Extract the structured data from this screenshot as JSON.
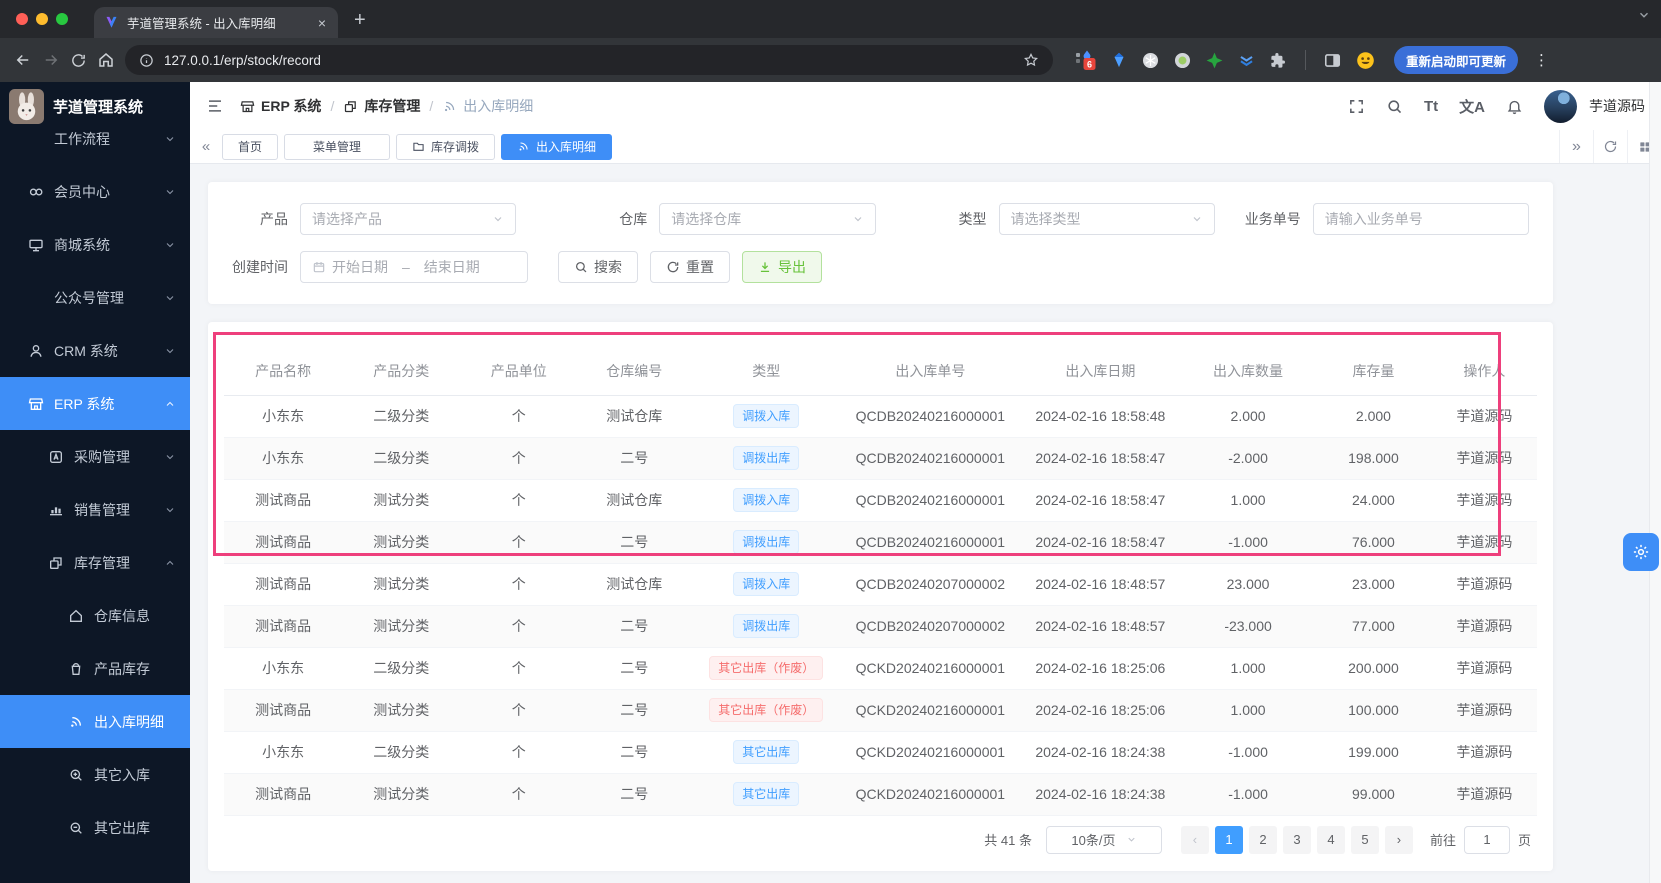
{
  "browser": {
    "tab_title": "芋道管理系统 - 出入库明细",
    "url": "127.0.0.1/erp/stock/record",
    "update_button": "重新启动即可更新",
    "extension_badge": "6"
  },
  "sidebar": {
    "logo_title": "芋道管理系统",
    "items": [
      {
        "label": "工作流程",
        "icon": null,
        "level": 1,
        "chevron": "down",
        "active": false
      },
      {
        "label": "会员中心",
        "icon": "member",
        "level": 1,
        "chevron": "down",
        "active": false
      },
      {
        "label": "商城系统",
        "icon": "mall",
        "level": 1,
        "chevron": "down",
        "active": false
      },
      {
        "label": "公众号管理",
        "icon": null,
        "level": 1,
        "chevron": "down",
        "active": false
      },
      {
        "label": "CRM 系统",
        "icon": "crm",
        "level": 1,
        "chevron": "down",
        "active": false
      },
      {
        "label": "ERP 系统",
        "icon": "erp",
        "level": 1,
        "chevron": "up",
        "active": true
      },
      {
        "label": "采购管理",
        "icon": "purchase",
        "level": 2,
        "chevron": "down",
        "active": false
      },
      {
        "label": "销售管理",
        "icon": "sales",
        "level": 2,
        "chevron": "down",
        "active": false
      },
      {
        "label": "库存管理",
        "icon": "stock",
        "level": 2,
        "chevron": "up",
        "active": false
      },
      {
        "label": "仓库信息",
        "icon": "warehouse",
        "level": 3,
        "chevron": null,
        "active": false
      },
      {
        "label": "产品库存",
        "icon": "product",
        "level": 3,
        "chevron": null,
        "active": false
      },
      {
        "label": "出入库明细",
        "icon": "record",
        "level": 3,
        "chevron": null,
        "active": true
      },
      {
        "label": "其它入库",
        "icon": "zoom-in",
        "level": 3,
        "chevron": null,
        "active": false
      },
      {
        "label": "其它出库",
        "icon": "zoom-out",
        "level": 3,
        "chevron": null,
        "active": false
      }
    ]
  },
  "header": {
    "breadcrumb": [
      {
        "label": "ERP 系统",
        "icon": "erp"
      },
      {
        "label": "库存管理",
        "icon": "stock"
      },
      {
        "label": "出入库明细",
        "icon": "record"
      }
    ],
    "username": "芋道源码"
  },
  "tabsbar": {
    "tabs": [
      {
        "label": "首页",
        "icon": null,
        "active": false,
        "wide": false
      },
      {
        "label": "菜单管理",
        "icon": null,
        "active": false,
        "wide": true
      },
      {
        "label": "库存调拨",
        "icon": "folder",
        "active": false,
        "wide": false
      },
      {
        "label": "出入库明细",
        "icon": "record",
        "active": true,
        "wide": false
      }
    ]
  },
  "filters": {
    "product": {
      "label": "产品",
      "placeholder": "请选择产品"
    },
    "warehouse": {
      "label": "仓库",
      "placeholder": "请选择仓库"
    },
    "type": {
      "label": "类型",
      "placeholder": "请选择类型"
    },
    "biz_no": {
      "label": "业务单号",
      "placeholder": "请输入业务单号"
    },
    "create_time": {
      "label": "创建时间",
      "start_placeholder": "开始日期",
      "separator": "–",
      "end_placeholder": "结束日期"
    },
    "search_button": "搜索",
    "reset_button": "重置",
    "export_button": "导出"
  },
  "table": {
    "columns": [
      "产品名称",
      "产品分类",
      "产品单位",
      "仓库编号",
      "类型",
      "出入库单号",
      "出入库日期",
      "出入库数量",
      "库存量",
      "操作人"
    ],
    "rows": [
      {
        "product": "小东东",
        "category": "二级分类",
        "unit": "个",
        "warehouse": "测试仓库",
        "type": "调拨入库",
        "type_style": "blue",
        "order_no": "QCDB20240216000001",
        "date": "2024-02-16 18:58:48",
        "qty": "2.000",
        "stock": "2.000",
        "operator": "芋道源码"
      },
      {
        "product": "小东东",
        "category": "二级分类",
        "unit": "个",
        "warehouse": "二号",
        "type": "调拨出库",
        "type_style": "blue",
        "order_no": "QCDB20240216000001",
        "date": "2024-02-16 18:58:47",
        "qty": "-2.000",
        "stock": "198.000",
        "operator": "芋道源码"
      },
      {
        "product": "测试商品",
        "category": "测试分类",
        "unit": "个",
        "warehouse": "测试仓库",
        "type": "调拨入库",
        "type_style": "blue",
        "order_no": "QCDB20240216000001",
        "date": "2024-02-16 18:58:47",
        "qty": "1.000",
        "stock": "24.000",
        "operator": "芋道源码"
      },
      {
        "product": "测试商品",
        "category": "测试分类",
        "unit": "个",
        "warehouse": "二号",
        "type": "调拨出库",
        "type_style": "blue",
        "order_no": "QCDB20240216000001",
        "date": "2024-02-16 18:58:47",
        "qty": "-1.000",
        "stock": "76.000",
        "operator": "芋道源码"
      },
      {
        "product": "测试商品",
        "category": "测试分类",
        "unit": "个",
        "warehouse": "测试仓库",
        "type": "调拨入库",
        "type_style": "blue",
        "order_no": "QCDB20240207000002",
        "date": "2024-02-16 18:48:57",
        "qty": "23.000",
        "stock": "23.000",
        "operator": "芋道源码"
      },
      {
        "product": "测试商品",
        "category": "测试分类",
        "unit": "个",
        "warehouse": "二号",
        "type": "调拨出库",
        "type_style": "blue",
        "order_no": "QCDB20240207000002",
        "date": "2024-02-16 18:48:57",
        "qty": "-23.000",
        "stock": "77.000",
        "operator": "芋道源码"
      },
      {
        "product": "小东东",
        "category": "二级分类",
        "unit": "个",
        "warehouse": "二号",
        "type": "其它出库（作废）",
        "type_style": "red",
        "order_no": "QCKD20240216000001",
        "date": "2024-02-16 18:25:06",
        "qty": "1.000",
        "stock": "200.000",
        "operator": "芋道源码"
      },
      {
        "product": "测试商品",
        "category": "测试分类",
        "unit": "个",
        "warehouse": "二号",
        "type": "其它出库（作废）",
        "type_style": "red",
        "order_no": "QCKD20240216000001",
        "date": "2024-02-16 18:25:06",
        "qty": "1.000",
        "stock": "100.000",
        "operator": "芋道源码"
      },
      {
        "product": "小东东",
        "category": "二级分类",
        "unit": "个",
        "warehouse": "二号",
        "type": "其它出库",
        "type_style": "blue",
        "order_no": "QCKD20240216000001",
        "date": "2024-02-16 18:24:38",
        "qty": "-1.000",
        "stock": "199.000",
        "operator": "芋道源码"
      },
      {
        "product": "测试商品",
        "category": "测试分类",
        "unit": "个",
        "warehouse": "二号",
        "type": "其它出库",
        "type_style": "blue",
        "order_no": "QCKD20240216000001",
        "date": "2024-02-16 18:24:38",
        "qty": "-1.000",
        "stock": "99.000",
        "operator": "芋道源码"
      }
    ]
  },
  "pagination": {
    "total": "共 41 条",
    "page_size": "10条/页",
    "pages": [
      "1",
      "2",
      "3",
      "4",
      "5"
    ],
    "active_page": "1",
    "goto_label": "前往",
    "goto_value": "1",
    "unit_label": "页"
  },
  "colors": {
    "accent": "#409eff",
    "sidebar_bg": "#0d1726",
    "tag_blue_text": "#409eff",
    "tag_blue_bg": "#ecf5ff",
    "tag_red_text": "#f56c6c",
    "tag_red_bg": "#fef0f0",
    "export_green": "#67c23a",
    "annotation_pink": "#ee3f7c"
  }
}
